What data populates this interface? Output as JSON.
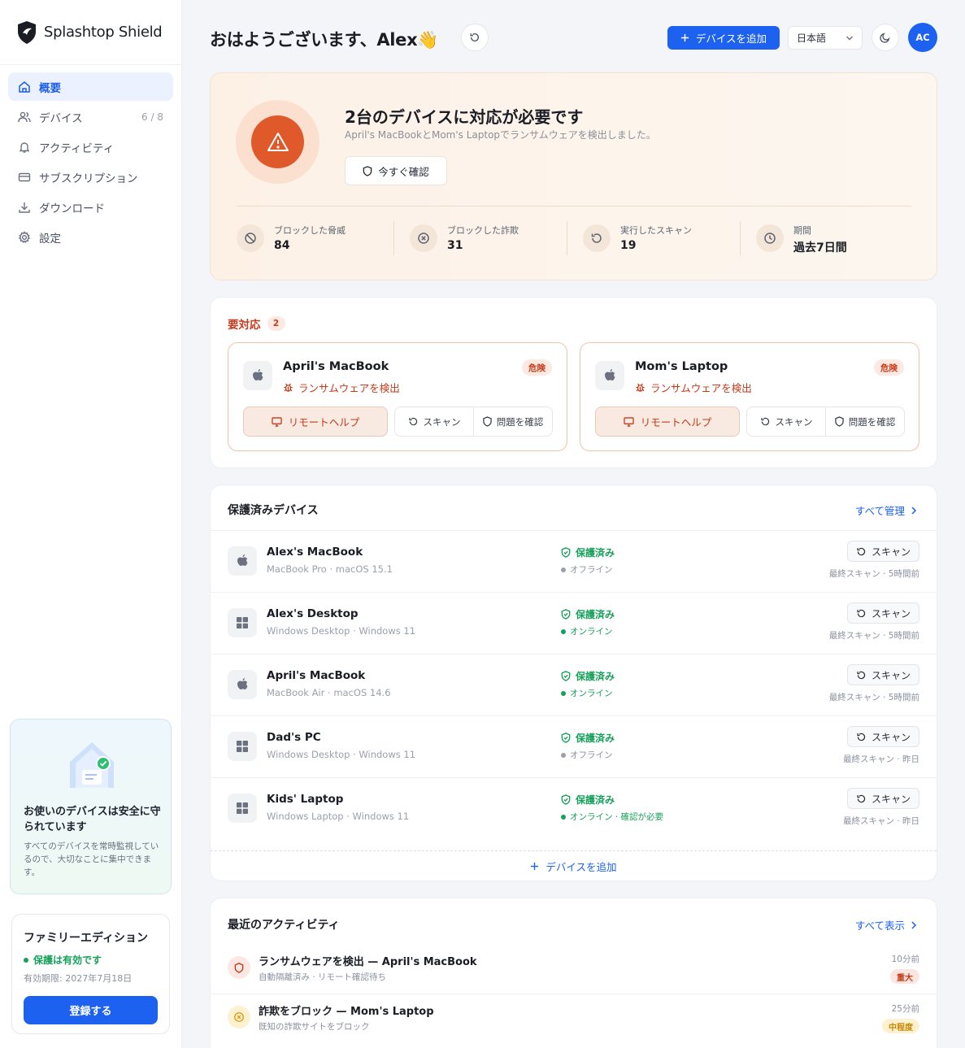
{
  "app": {
    "brand_name": "Splashtop Shield"
  },
  "sidebar": {
    "items": [
      {
        "label": "概要",
        "icon": "home-icon",
        "active": true
      },
      {
        "label": "デバイス",
        "icon": "users-icon",
        "count": "6 / 8"
      },
      {
        "label": "アクティビティ",
        "icon": "bell-icon"
      },
      {
        "label": "サブスクリプション",
        "icon": "credit-card-icon"
      },
      {
        "label": "ダウンロード",
        "icon": "download-icon"
      },
      {
        "label": "設定",
        "icon": "gear-icon"
      }
    ],
    "safe_card": {
      "title": "お使いのデバイスは安全に守られています",
      "description": "すべてのデバイスを常時監視しているので、大切なことに集中できます。"
    },
    "plan": {
      "title": "ファミリーエディション",
      "status": "保護は有効です",
      "expiry": "有効期限: 2027年7月18日",
      "button": "登録する"
    }
  },
  "header": {
    "greeting": "おはようございます、Alex👋",
    "add_device": "デバイスを追加",
    "language": "日本語",
    "avatar": "AC"
  },
  "alert": {
    "title": "2台のデバイスに対応が必要です",
    "description": "April's MacBookとMom's Laptopでランサムウェアを検出しました。",
    "button": "今すぐ確認",
    "stats": [
      {
        "label": "ブロックした脅威",
        "value": "84",
        "icon": "block-icon"
      },
      {
        "label": "ブロックした詐欺",
        "value": "31",
        "icon": "x-circle-icon"
      },
      {
        "label": "実行したスキャン",
        "value": "19",
        "icon": "rotate-icon"
      },
      {
        "label": "期間",
        "value": "過去7日間",
        "icon": "clock-icon"
      }
    ]
  },
  "attention": {
    "title": "要対応",
    "count": "2",
    "devices": [
      {
        "name": "April's MacBook",
        "threat": "ランサムウェアを検出",
        "badge": "危険",
        "remote": "リモートヘルプ",
        "scan": "スキャン",
        "review": "問題を確認"
      },
      {
        "name": "Mom's Laptop",
        "threat": "ランサムウェアを検出",
        "badge": "危険",
        "remote": "リモートヘルプ",
        "scan": "スキャン",
        "review": "問題を確認"
      }
    ]
  },
  "protected": {
    "title": "保護済みデバイス",
    "manage_all": "すべて管理",
    "add_device": "デバイスを追加",
    "devices": [
      {
        "name": "Alex's MacBook",
        "model": "MacBook Pro · macOS 15.1",
        "status": "保護済み",
        "connection": "オフライン",
        "online": false,
        "os": "apple",
        "scan": "スキャン",
        "last_scan": "最終スキャン · 5時間前"
      },
      {
        "name": "Alex's Desktop",
        "model": "Windows Desktop · Windows 11",
        "status": "保護済み",
        "connection": "オンライン",
        "online": true,
        "os": "windows",
        "scan": "スキャン",
        "last_scan": "最終スキャン · 5時間前"
      },
      {
        "name": "April's MacBook",
        "model": "MacBook Air · macOS 14.6",
        "status": "保護済み",
        "connection": "オンライン",
        "online": true,
        "os": "apple",
        "scan": "スキャン",
        "last_scan": "最終スキャン · 5時間前"
      },
      {
        "name": "Dad's PC",
        "model": "Windows Desktop · Windows 11",
        "status": "保護済み",
        "connection": "オフライン",
        "online": false,
        "os": "windows",
        "scan": "スキャン",
        "last_scan": "最終スキャン · 昨日"
      },
      {
        "name": "Kids' Laptop",
        "model": "Windows Laptop · Windows 11",
        "status": "保護済み",
        "connection": "オンライン · 確認が必要",
        "online": true,
        "os": "windows",
        "scan": "スキャン",
        "last_scan": "最終スキャン · 昨日"
      }
    ]
  },
  "activity": {
    "title": "最近のアクティビティ",
    "view_all": "すべて表示",
    "items": [
      {
        "title": "ランサムウェアを検出 — April's MacBook",
        "sub": "自動隔離済み · リモート確認待ち",
        "time": "10分前",
        "badge": "重大",
        "severity": "critical"
      },
      {
        "title": "詐欺をブロック — Mom's Laptop",
        "sub": "既知の詐欺サイトをブロック",
        "time": "25分前",
        "badge": "中程度",
        "severity": "medium"
      }
    ]
  },
  "colors": {
    "accent": "#1c61ef",
    "danger": "#c63a1a",
    "success": "#16a05a",
    "warning": "#d99a0b"
  }
}
